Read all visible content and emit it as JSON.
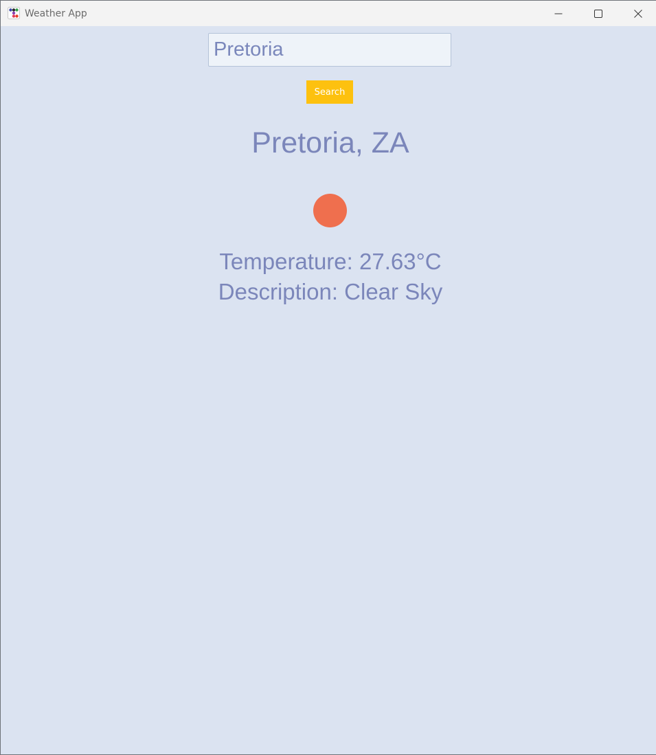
{
  "window": {
    "title": "Weather App",
    "app_icon": "color-dots-icon",
    "controls": [
      "minimize-icon",
      "maximize-icon",
      "close-icon"
    ]
  },
  "search": {
    "value": "Pretoria",
    "button_label": "Search"
  },
  "weather": {
    "city": "Pretoria, ZA",
    "icon": "weather-circle-icon",
    "icon_color": "#ef6f4e",
    "temperature_text": "Temperature: 27.63°C",
    "description_text": "Description: Clear Sky"
  },
  "colors": {
    "background": "#dbe3f1",
    "accent_button": "#fdc10f",
    "text": "#7b86ba"
  }
}
